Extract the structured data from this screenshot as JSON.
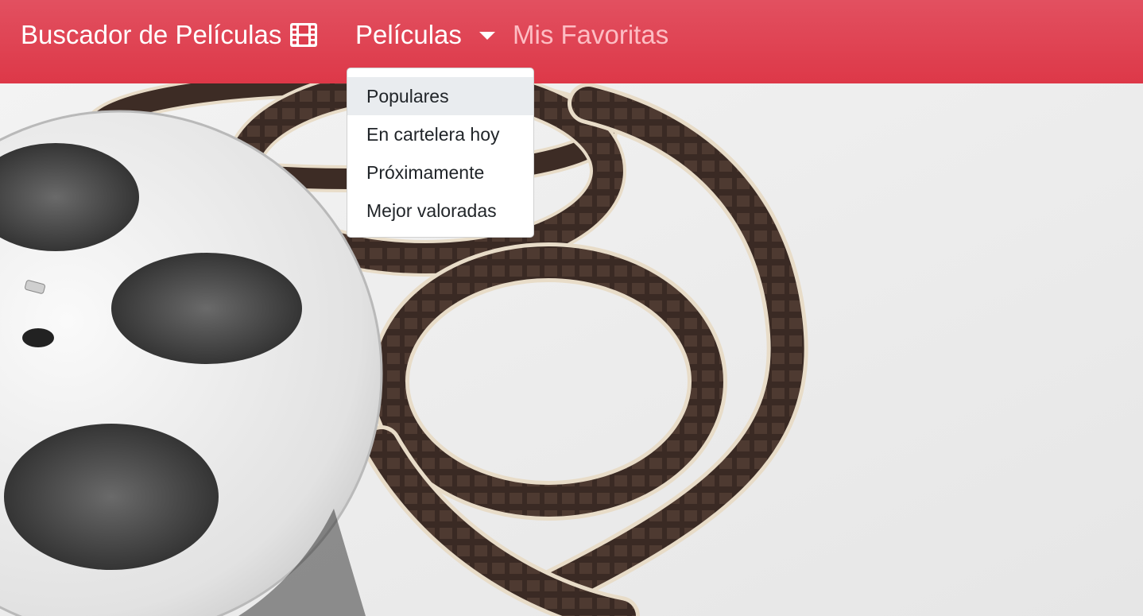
{
  "navbar": {
    "brand_label": "Buscador de Películas",
    "brand_icon": "film-icon",
    "dropdown_label": "Películas",
    "dropdown_icon": "caret-down-icon",
    "favorites_label": "Mis Favoritas",
    "background_color": "#dc3545"
  },
  "dropdown": {
    "items": [
      {
        "label": "Populares",
        "active": true
      },
      {
        "label": "En cartelera hoy",
        "active": false
      },
      {
        "label": "Próximamente",
        "active": false
      },
      {
        "label": "Mejor valoradas",
        "active": false
      }
    ]
  },
  "hero": {
    "image": "film-reel-hero-image"
  }
}
